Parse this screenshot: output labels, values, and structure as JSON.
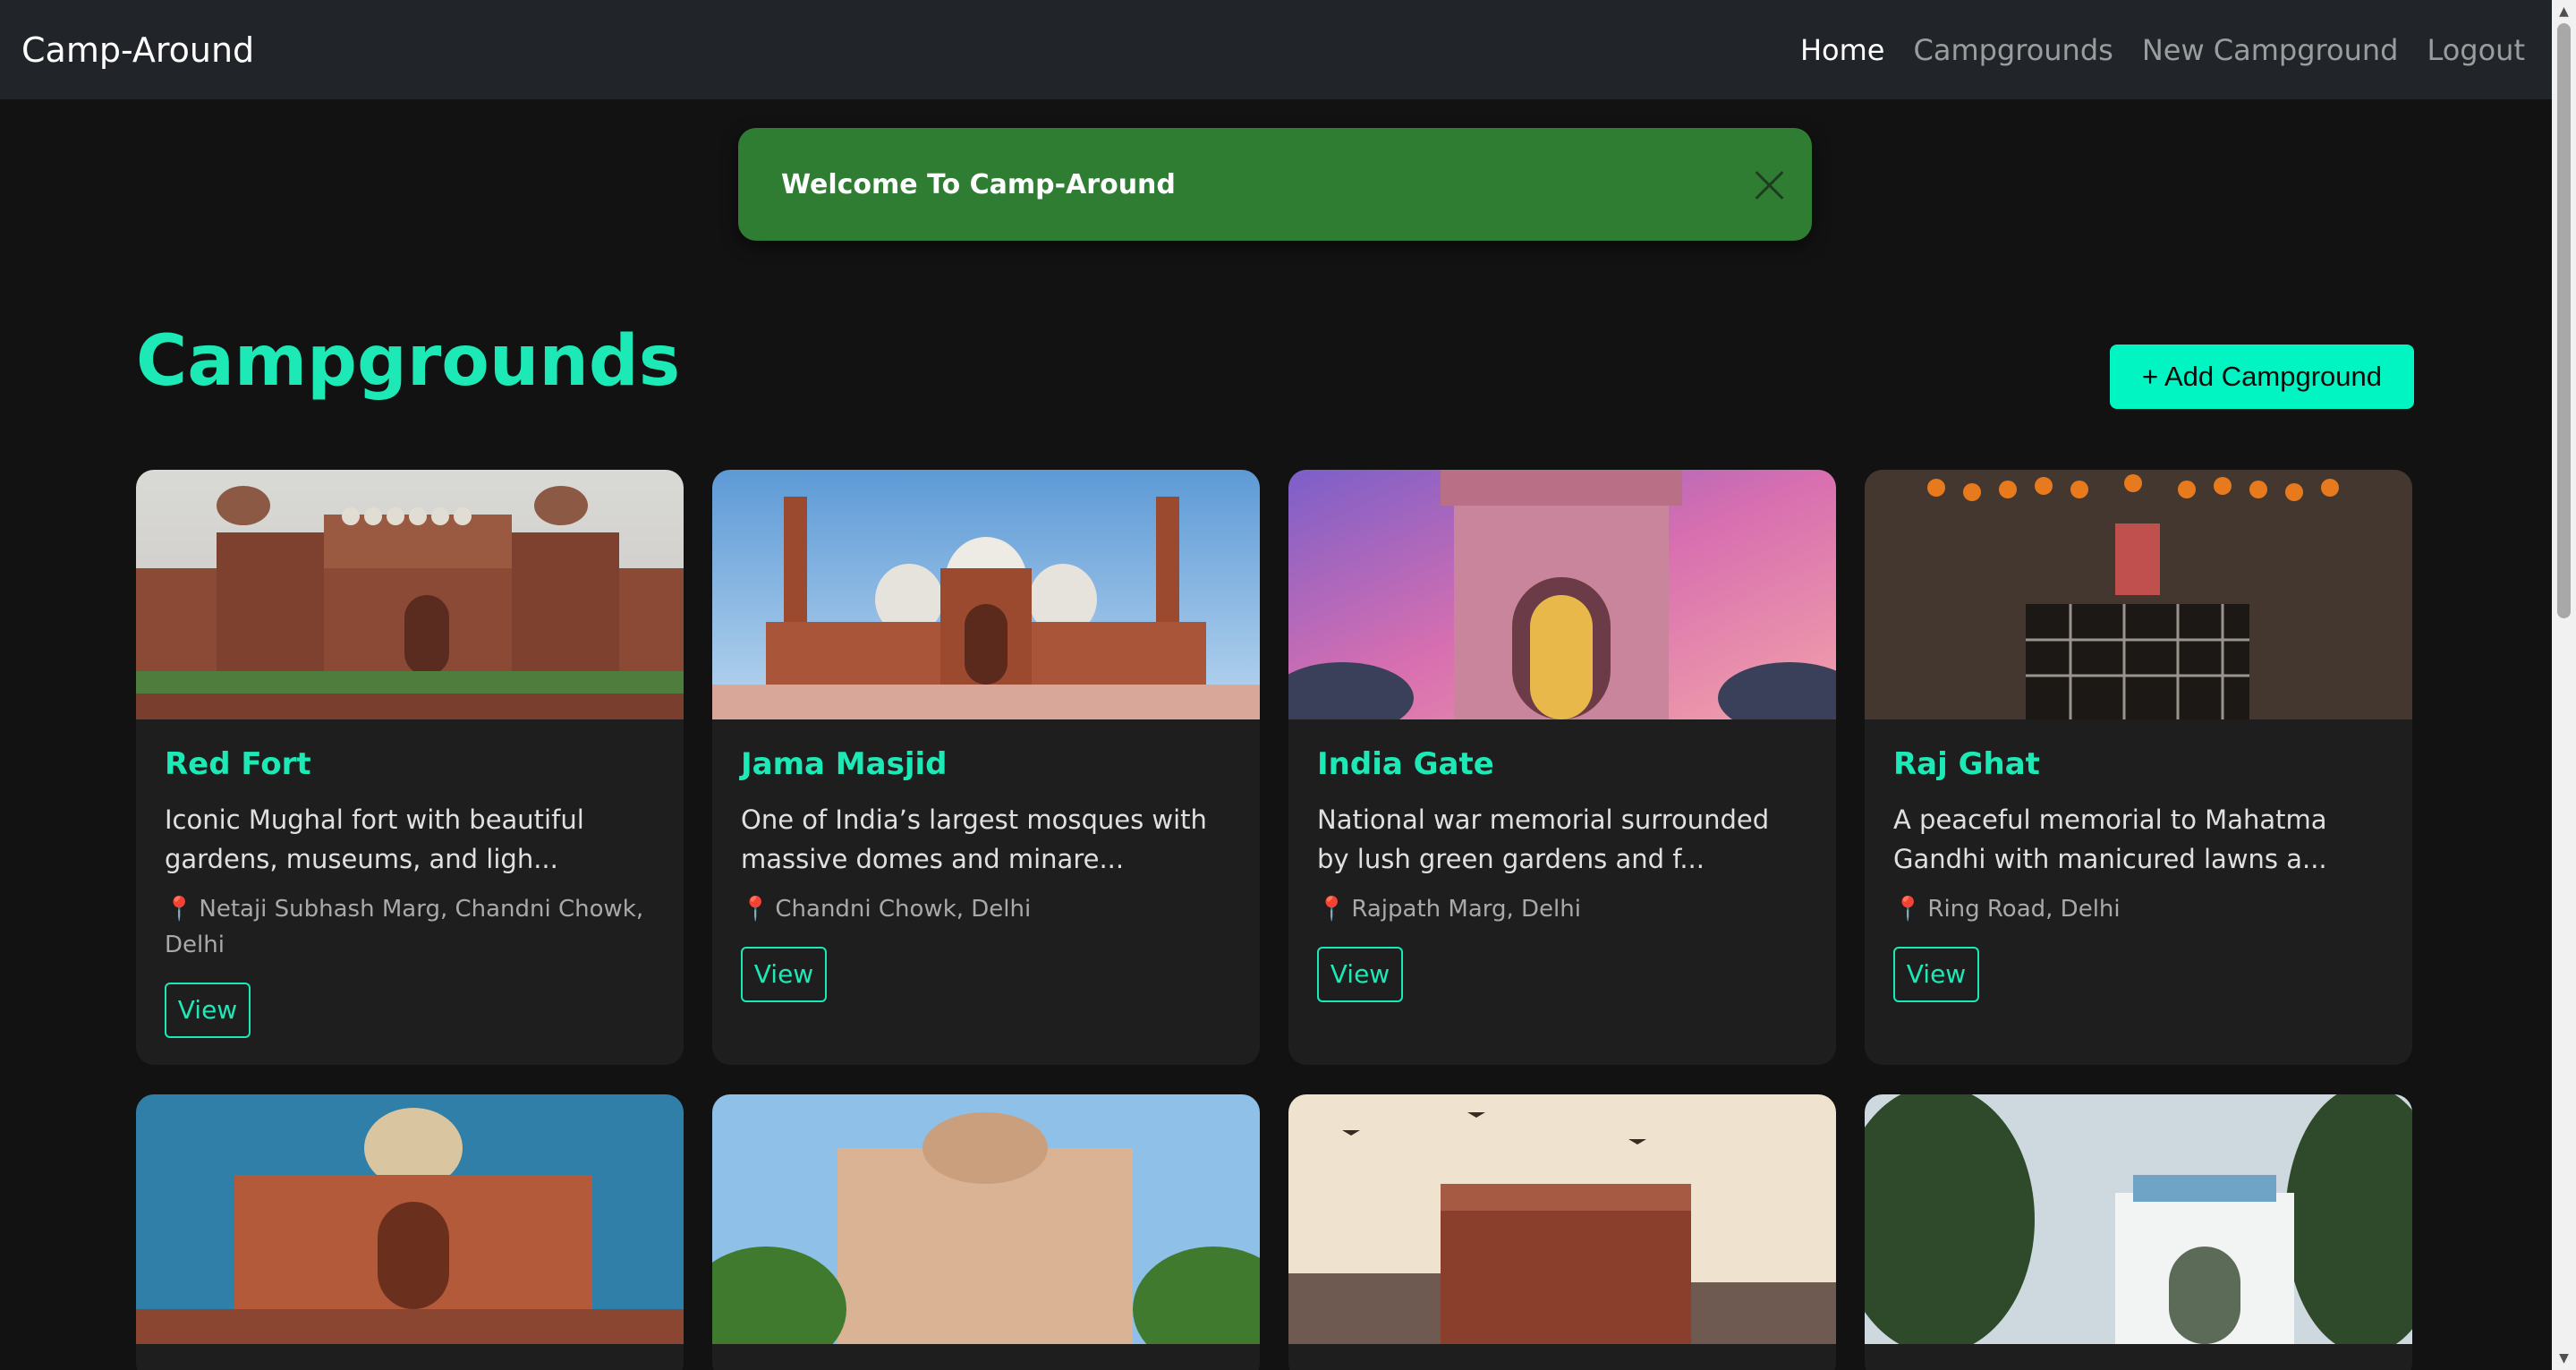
{
  "nav": {
    "brand": "Camp-Around",
    "links": [
      {
        "label": "Home",
        "active": true
      },
      {
        "label": "Campgrounds",
        "active": false
      },
      {
        "label": "New Campground",
        "active": false
      },
      {
        "label": "Logout",
        "active": false
      }
    ]
  },
  "flash": {
    "message": "Welcome To Camp-Around",
    "color": "#2e7d32"
  },
  "header": {
    "title": "Campgrounds",
    "add_button": "+ Add Campground"
  },
  "theme": {
    "accent": "#1de9b6",
    "button_bg": "#00f5c3",
    "background": "#121212",
    "card_bg": "#1e1e1e"
  },
  "campgrounds": [
    {
      "title": "Red Fort",
      "description": "Iconic Mughal fort with beautiful gardens, museums, and ligh...",
      "location": "Netaji Subhash Marg, Chandni Chowk, Delhi",
      "view_label": "View"
    },
    {
      "title": "Jama Masjid",
      "description": "One of India’s largest mosques with massive domes and minare...",
      "location": "Chandni Chowk, Delhi",
      "view_label": "View"
    },
    {
      "title": "India Gate",
      "description": "National war memorial surrounded by lush green gardens and f...",
      "location": "Rajpath Marg, Delhi",
      "view_label": "View"
    },
    {
      "title": "Raj Ghat",
      "description": "A peaceful memorial to Mahatma Gandhi with manicured lawns a...",
      "location": "Ring Road, Delhi",
      "view_label": "View"
    }
  ]
}
